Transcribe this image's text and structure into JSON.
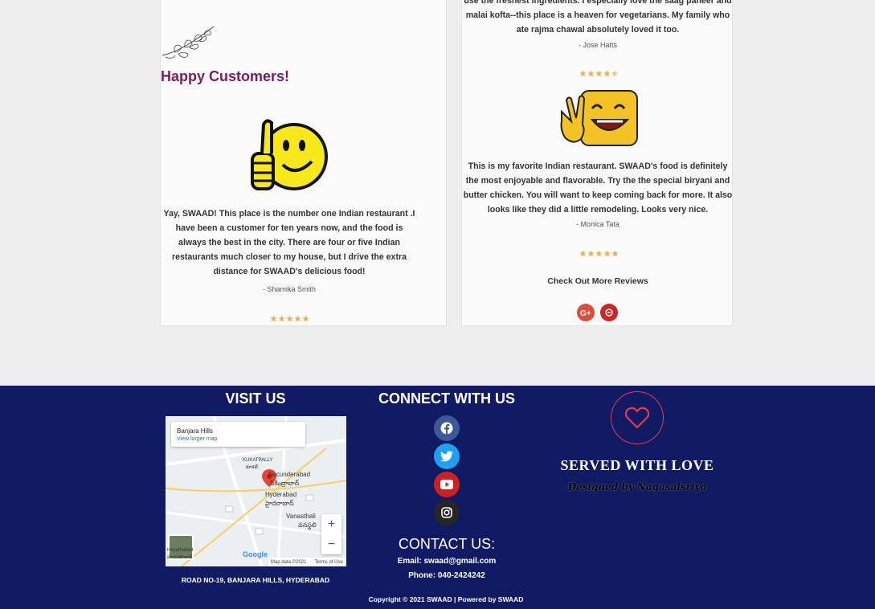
{
  "section": {
    "title": "Happy Customers!"
  },
  "reviews": [
    {
      "text": "use the freshest ingredients. I especially love the saag paneer and malai kofta--this place is a heaven for vegetarians. My family who ate rajma chawal absolutely loved it too.",
      "author": "- Jose Hatts",
      "rating": 4.5
    },
    {
      "text": "Yay, SWAAD! This place is the number one Indian restaurant .I have been a customer for ten years now, and the food is always the best in the city. There are four or five Indian restaurants much closer to my house, but I drive the extra distance for SWAAD's delicious food!",
      "author": "- Shamika Smith",
      "rating": 5
    },
    {
      "text": "This is my favorite Indian restaurant. SWAAD's food is definitely the most enjoyable and flavorable. Try the the special biryani and butter chicken. You will want to keep coming back for more. It also looks like they did a little remodeling. Looks very nice.",
      "author": "- Monica Tata",
      "rating": 5
    }
  ],
  "more_reviews": {
    "label": "Check Out More Reviews",
    "icons": [
      "google-plus-icon",
      "yelp-icon"
    ]
  },
  "footer": {
    "visit_heading": "VISIT US",
    "map": {
      "place": "Banjara Hills",
      "larger_link": "View larger map",
      "labels": [
        "KUKATPALLY",
        "కూకట్",
        "Secunderabad",
        "సికింద్రాబాద్",
        "Hyderabad",
        "హైదరాబాద్",
        "Vanasthali",
        "వనస్థలి",
        "Hayathabad",
        "హయతాబాద్"
      ],
      "map_data": "Map data ©2021",
      "terms": "Terms of Use",
      "brand": "Google"
    },
    "address": "ROAD NO-19, BANJARA HILLS, HYDERABAD",
    "connect_heading": "CONNECT WITH US",
    "socials": [
      {
        "name": "facebook-icon",
        "color": "#3b5998"
      },
      {
        "name": "twitter-icon",
        "color": "#1da1f2"
      },
      {
        "name": "youtube-icon",
        "color": "#cd201f"
      },
      {
        "name": "instagram-icon",
        "color": "#262626"
      }
    ],
    "contact_heading": "CONTACT US:",
    "email": "Email: swaad@gmail.com",
    "phone": "Phone: 040-2424242",
    "served": "SERVED WITH LOVE",
    "designed": "Designed by Nagasaisriya",
    "copyright": "Copyright © 2021 SWAAD | Powered by SWAAD"
  },
  "colors": {
    "accent_purple": "#7a1d5a",
    "footer_bg": "#111b63",
    "star": "#f0ad4e",
    "heart": "#e23a4f"
  }
}
